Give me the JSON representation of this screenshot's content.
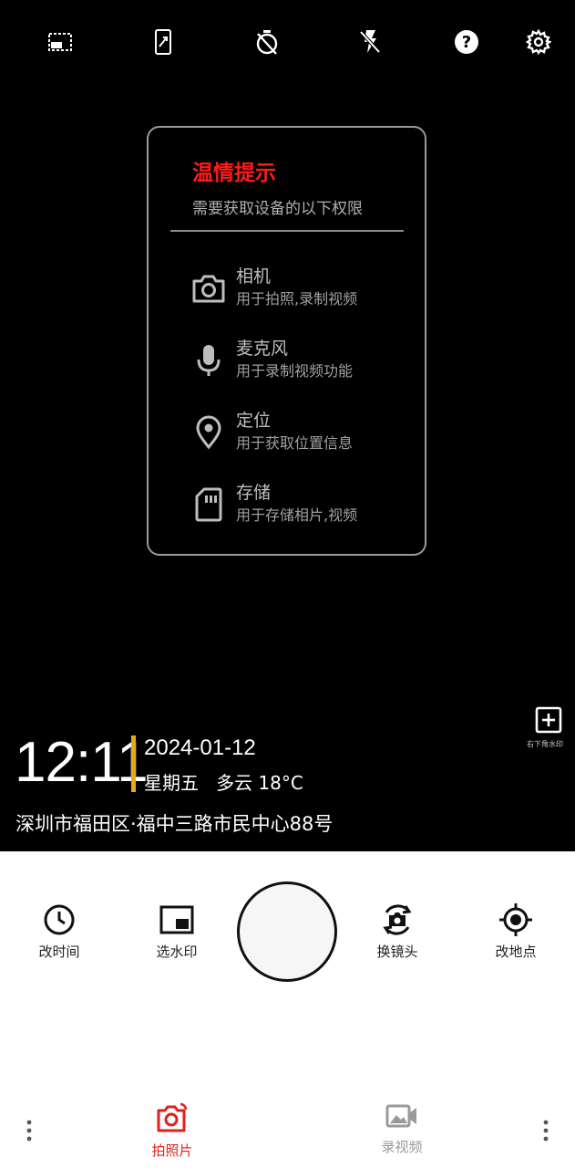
{
  "topbar": {
    "icons": [
      "aspect-ratio-icon",
      "phone-orientation-icon",
      "timer-off-icon",
      "flash-off-icon",
      "help-icon",
      "gear-icon"
    ]
  },
  "dialog": {
    "title": "温情提示",
    "subtitle": "需要获取设备的以下权限",
    "permissions": [
      {
        "name": "相机",
        "desc": "用于拍照,录制视频",
        "icon": "camera-icon"
      },
      {
        "name": "麦克风",
        "desc": "用于录制视频功能",
        "icon": "microphone-icon"
      },
      {
        "name": "定位",
        "desc": "用于获取位置信息",
        "icon": "location-pin-icon"
      },
      {
        "name": "存储",
        "desc": "用于存储相片,视频",
        "icon": "sd-card-icon"
      }
    ]
  },
  "watermark": {
    "add_label": "右下角水印",
    "time": "12:11",
    "date": "2024-01-12",
    "weekday_weather": "星期五   多云 18°C",
    "address": "深圳市福田区·福中三路市民中心88号",
    "accent_color": "#e8a918"
  },
  "tools": {
    "change_time": "改时间",
    "choose_watermark": "选水印",
    "switch_camera": "换镜头",
    "change_location": "改地点"
  },
  "modes": {
    "photo": "拍照片",
    "video": "录视频",
    "active_color": "#e0201c",
    "inactive_color": "#9a9a9a"
  }
}
